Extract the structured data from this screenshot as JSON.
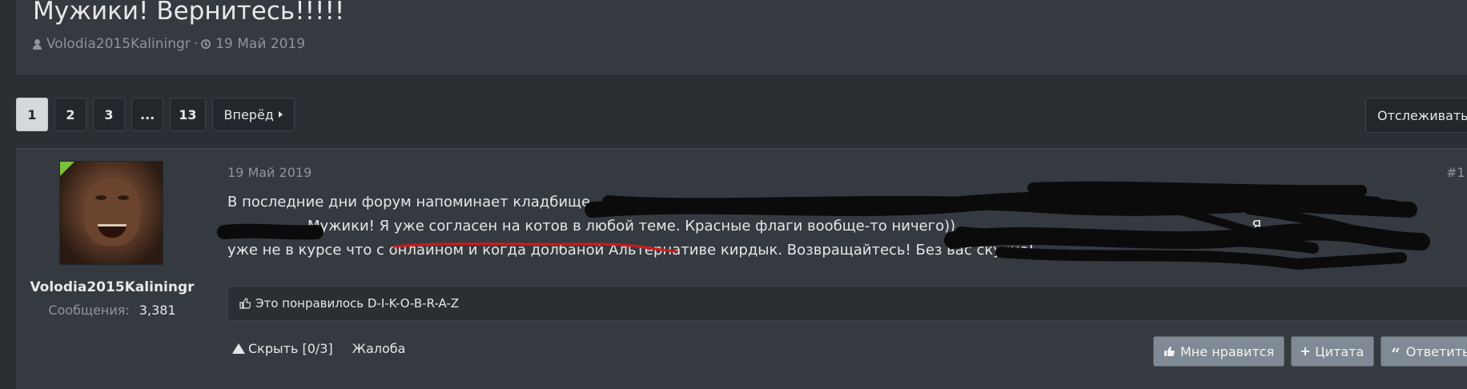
{
  "topic": {
    "title": "Мужики! Вернитесь!!!!!",
    "author": "Volodia2015Kaliningr",
    "separator": "·",
    "date": "19 Май 2019",
    "icons": [
      "user-icon",
      "clock-icon"
    ]
  },
  "pagination": {
    "pages": [
      "1",
      "2",
      "3",
      "...",
      "13"
    ],
    "active_page": "1",
    "next_label": "Вперёд",
    "follow_label": "Отслеживать"
  },
  "post": {
    "author": {
      "name": "Volodia2015Kaliningr",
      "posts_label": "Сообщения:",
      "posts_value": "3,381",
      "online": true
    },
    "date": "19 Май 2019",
    "number": "#1",
    "body": {
      "line1": "В последние дни форум напоминает кладбище.",
      "line2": "Мужики! Я уже согласен на котов в любой теме. Красные флаги вообще-то ничего))",
      "line2_tail": "Я",
      "line3": "уже не в курсе что с онлайном и когда долбаной Альтернативе кирдык. Возвращайтесь! Без вас скучно!"
    },
    "likes_text": "Это понравилось D-I-K-O-B-R-A-Z",
    "actions_left": {
      "hide": "Скрыть [0/3]",
      "report": "Жалоба"
    },
    "actions_right": {
      "like": "Мне нравится",
      "quote": "Цитата",
      "reply": "Ответить"
    }
  },
  "colors": {
    "background": "#2b2e33",
    "panel": "#353a40",
    "muted_text": "#8c949c",
    "online_indicator": "#78c03a",
    "underline_annotation": "#d11a1a",
    "action_button": "#7f8a94"
  }
}
